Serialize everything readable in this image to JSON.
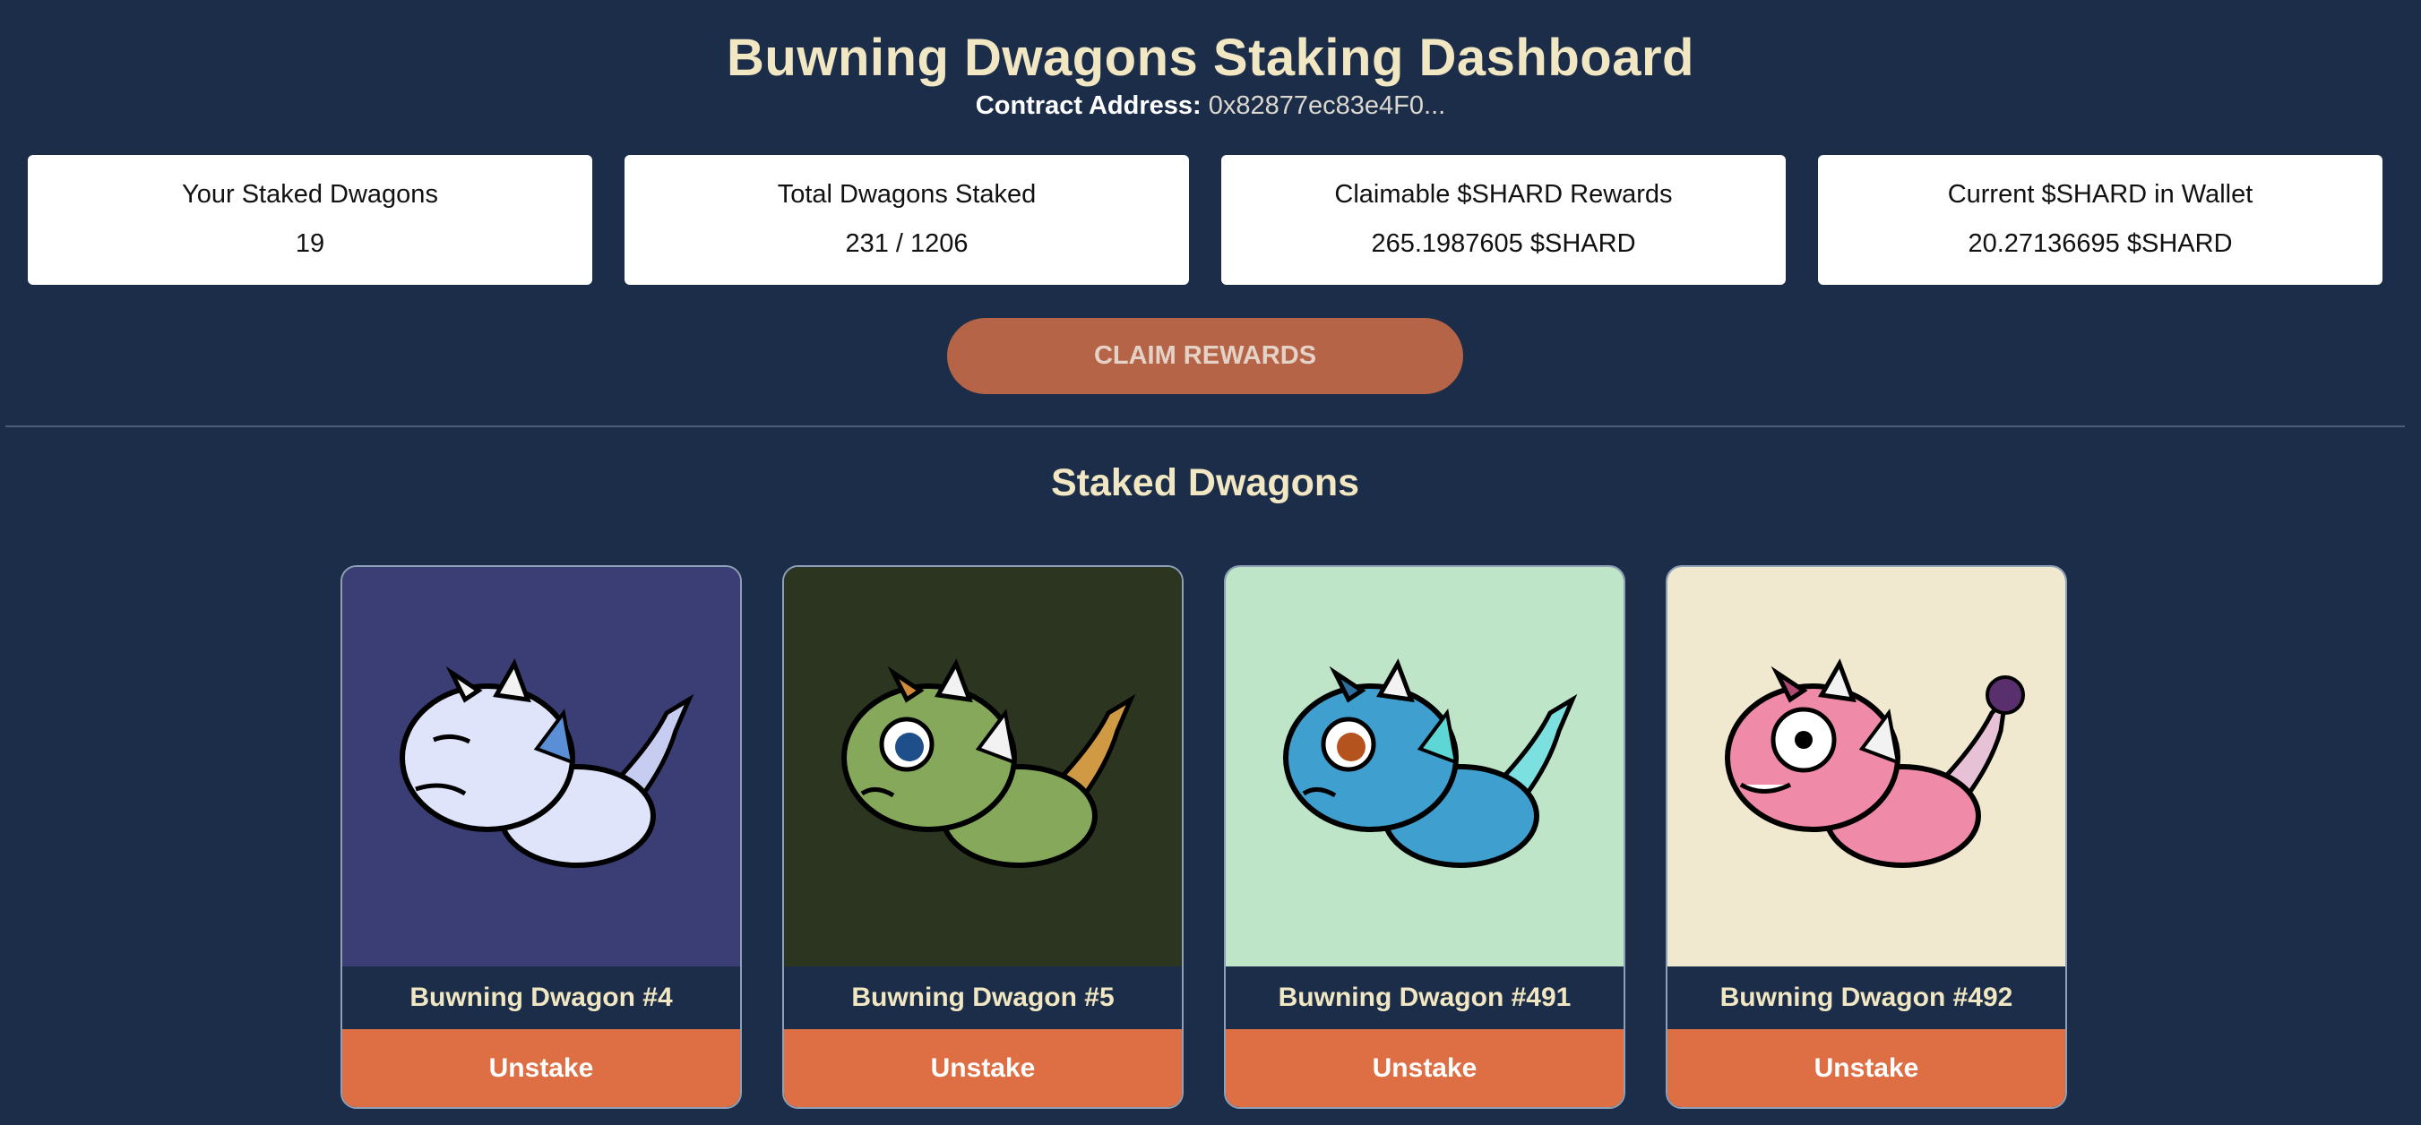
{
  "header": {
    "title": "Buwning Dwagons Staking Dashboard",
    "contract_label": "Contract Address:",
    "contract_address": "0x82877ec83e4F0..."
  },
  "stats": [
    {
      "label": "Your Staked Dwagons",
      "value": "19"
    },
    {
      "label": "Total Dwagons Staked",
      "value": "231 / 1206"
    },
    {
      "label": "Claimable $SHARD Rewards",
      "value": "265.1987605 $SHARD"
    },
    {
      "label": "Current $SHARD in Wallet",
      "value": "20.27136695 $SHARD"
    }
  ],
  "claim_button": "CLAIM REWARDS",
  "section_title": "Staked Dwagons",
  "dragons": [
    {
      "name": "Buwning Dwagon #4",
      "button": "Unstake",
      "bg": "#3b3e75",
      "body": "#dfe4fb",
      "icon": "dragon-white-icon"
    },
    {
      "name": "Buwning Dwagon #5",
      "button": "Unstake",
      "bg": "#2b3520",
      "body": "#86a85a",
      "icon": "dragon-green-icon"
    },
    {
      "name": "Buwning Dwagon #491",
      "button": "Unstake",
      "bg": "#bfe5c8",
      "body": "#3fa0cf",
      "icon": "dragon-blue-icon"
    },
    {
      "name": "Buwning Dwagon #492",
      "button": "Unstake",
      "bg": "#f1e9cf",
      "body": "#ef8aa8",
      "icon": "dragon-pink-icon"
    }
  ]
}
